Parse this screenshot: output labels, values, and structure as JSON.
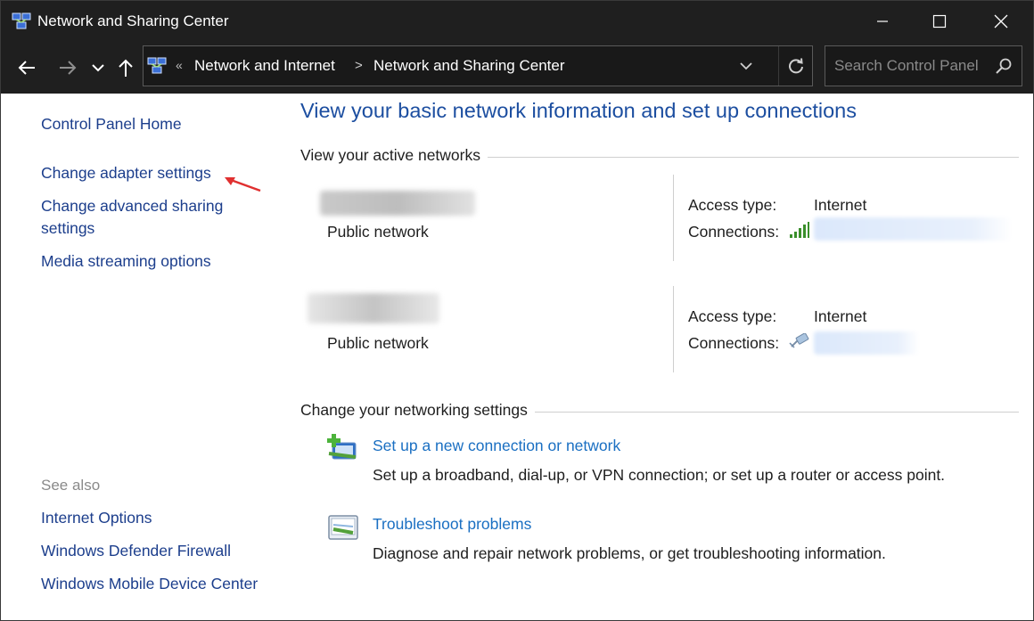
{
  "window": {
    "title": "Network and Sharing Center",
    "controls": [
      "minimize",
      "maximize",
      "close"
    ]
  },
  "navigation": {
    "back": "back-arrow",
    "forward": "forward-arrow",
    "recent": "chevron-down",
    "up": "up-arrow",
    "overflow": "«",
    "breadcrumb": [
      "Network and Internet",
      "Network and Sharing Center"
    ],
    "separator": ">",
    "search_placeholder": "Search Control Panel"
  },
  "sidebar": {
    "home": "Control Panel Home",
    "links": [
      "Change adapter settings",
      "Change advanced sharing",
      "settings",
      "Media streaming options"
    ],
    "see_also_label": "See also",
    "see_also": [
      "Internet Options",
      "Windows Defender Firewall",
      "Windows Mobile Device Center"
    ]
  },
  "main": {
    "title": "View your basic network information and set up connections",
    "active_networks_header": "View your active networks",
    "networks": [
      {
        "type": "Public network",
        "access_label": "Access type:",
        "access_value": "Internet",
        "connections_label": "Connections:",
        "connection_icon": "wifi-signal-icon"
      },
      {
        "type": "Public network",
        "access_label": "Access type:",
        "access_value": "Internet",
        "connections_label": "Connections:",
        "connection_icon": "ethernet-icon"
      }
    ],
    "settings_header": "Change your networking settings",
    "tasks": [
      {
        "link": "Set up a new connection or network",
        "description": "Set up a broadband, dial-up, or VPN connection; or set up a router or access point."
      },
      {
        "link": "Troubleshoot problems",
        "description": "Diagnose and repair network problems, or get troubleshooting information."
      }
    ]
  },
  "colors": {
    "titlebar": "#1f1f1f",
    "link_sidebar": "#1c3e8c",
    "title_blue": "#1c4ea0",
    "task_link": "#1a6fc2",
    "annotation_arrow": "#e03030"
  }
}
